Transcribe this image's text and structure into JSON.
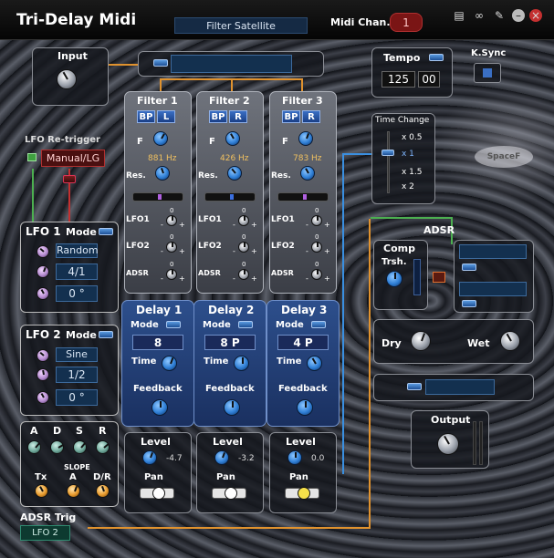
{
  "title": "Tri-Delay Midi",
  "preset": "Filter Satellite",
  "midi": {
    "label": "Midi Chan.",
    "value": "1"
  },
  "titlebar_icons": [
    "book-icon",
    "link-icon",
    "pin-icon",
    "minimize-icon",
    "close-icon"
  ],
  "input": {
    "label": "Input"
  },
  "tempo": {
    "label": "Tempo",
    "bpm": "125",
    "fraction": "00"
  },
  "ksync": {
    "label": "K.Sync"
  },
  "time_change": {
    "label": "Time Change",
    "options": [
      "x 0.5",
      "x 1",
      "x 1.5",
      "x 2"
    ],
    "selected_index": 1
  },
  "lfo_retrigger": {
    "label": "LFO Re-trigger",
    "value": "Manual/LG"
  },
  "filters": [
    {
      "title": "Filter 1",
      "type": "BP",
      "channel": "L",
      "f_label": "F",
      "freq": "881 Hz",
      "res_label": "Res.",
      "lfo1": "LFO1",
      "lfo2": "LFO2",
      "adsr": "ADSR",
      "zero": "0",
      "minus": "-",
      "plus": "+"
    },
    {
      "title": "Filter 2",
      "type": "BP",
      "channel": "R",
      "f_label": "F",
      "freq": "426 Hz",
      "res_label": "Res.",
      "lfo1": "LFO1",
      "lfo2": "LFO2",
      "adsr": "ADSR",
      "zero": "0",
      "minus": "-",
      "plus": "+"
    },
    {
      "title": "Filter 3",
      "type": "BP",
      "channel": "R",
      "f_label": "F",
      "freq": "783 Hz",
      "res_label": "Res.",
      "lfo1": "LFO1",
      "lfo2": "LFO2",
      "adsr": "ADSR",
      "zero": "0",
      "minus": "-",
      "plus": "+"
    }
  ],
  "delays": [
    {
      "title": "Delay 1",
      "mode_label": "Mode",
      "mode": "8",
      "time_label": "Time",
      "feedback_label": "Feedback"
    },
    {
      "title": "Delay 2",
      "mode_label": "Mode",
      "mode": "8 P",
      "time_label": "Time",
      "feedback_label": "Feedback"
    },
    {
      "title": "Delay 3",
      "mode_label": "Mode",
      "mode": "4 P",
      "time_label": "Time",
      "feedback_label": "Feedback"
    }
  ],
  "levels": [
    {
      "level_label": "Level",
      "value": "-4.7",
      "pan_label": "Pan"
    },
    {
      "level_label": "Level",
      "value": "-3.2",
      "pan_label": "Pan"
    },
    {
      "level_label": "Level",
      "value": "0.0",
      "pan_label": "Pan"
    }
  ],
  "lfo1": {
    "title": "LFO 1",
    "mode_label": "Mode",
    "shape": "Random",
    "rate": "4/1",
    "phase": "0 °"
  },
  "lfo2": {
    "title": "LFO 2",
    "mode_label": "Mode",
    "shape": "Sine",
    "rate": "1/2",
    "phase": "0 °"
  },
  "adsr_panel": {
    "a": "A",
    "d": "D",
    "s": "S",
    "r": "R",
    "slope": "SLOPE",
    "tx": "Tx",
    "slope_a": "A",
    "slope_dr": "D/R"
  },
  "adsr_trig": {
    "label": "ADSR Trig",
    "value": "LFO 2"
  },
  "comp": {
    "title": "Comp",
    "threshold": "Trsh.",
    "adsr_label": "ADSR"
  },
  "mix": {
    "dry": "Dry",
    "wet": "Wet"
  },
  "output": {
    "label": "Output"
  },
  "logo": "SpaceF",
  "colors": {
    "accent_blue": "#2f7fd6",
    "wire_orange": "#e0922e",
    "wire_blue": "#3a8fe0",
    "wire_green": "#4caf50",
    "record_red": "#7a1515"
  }
}
